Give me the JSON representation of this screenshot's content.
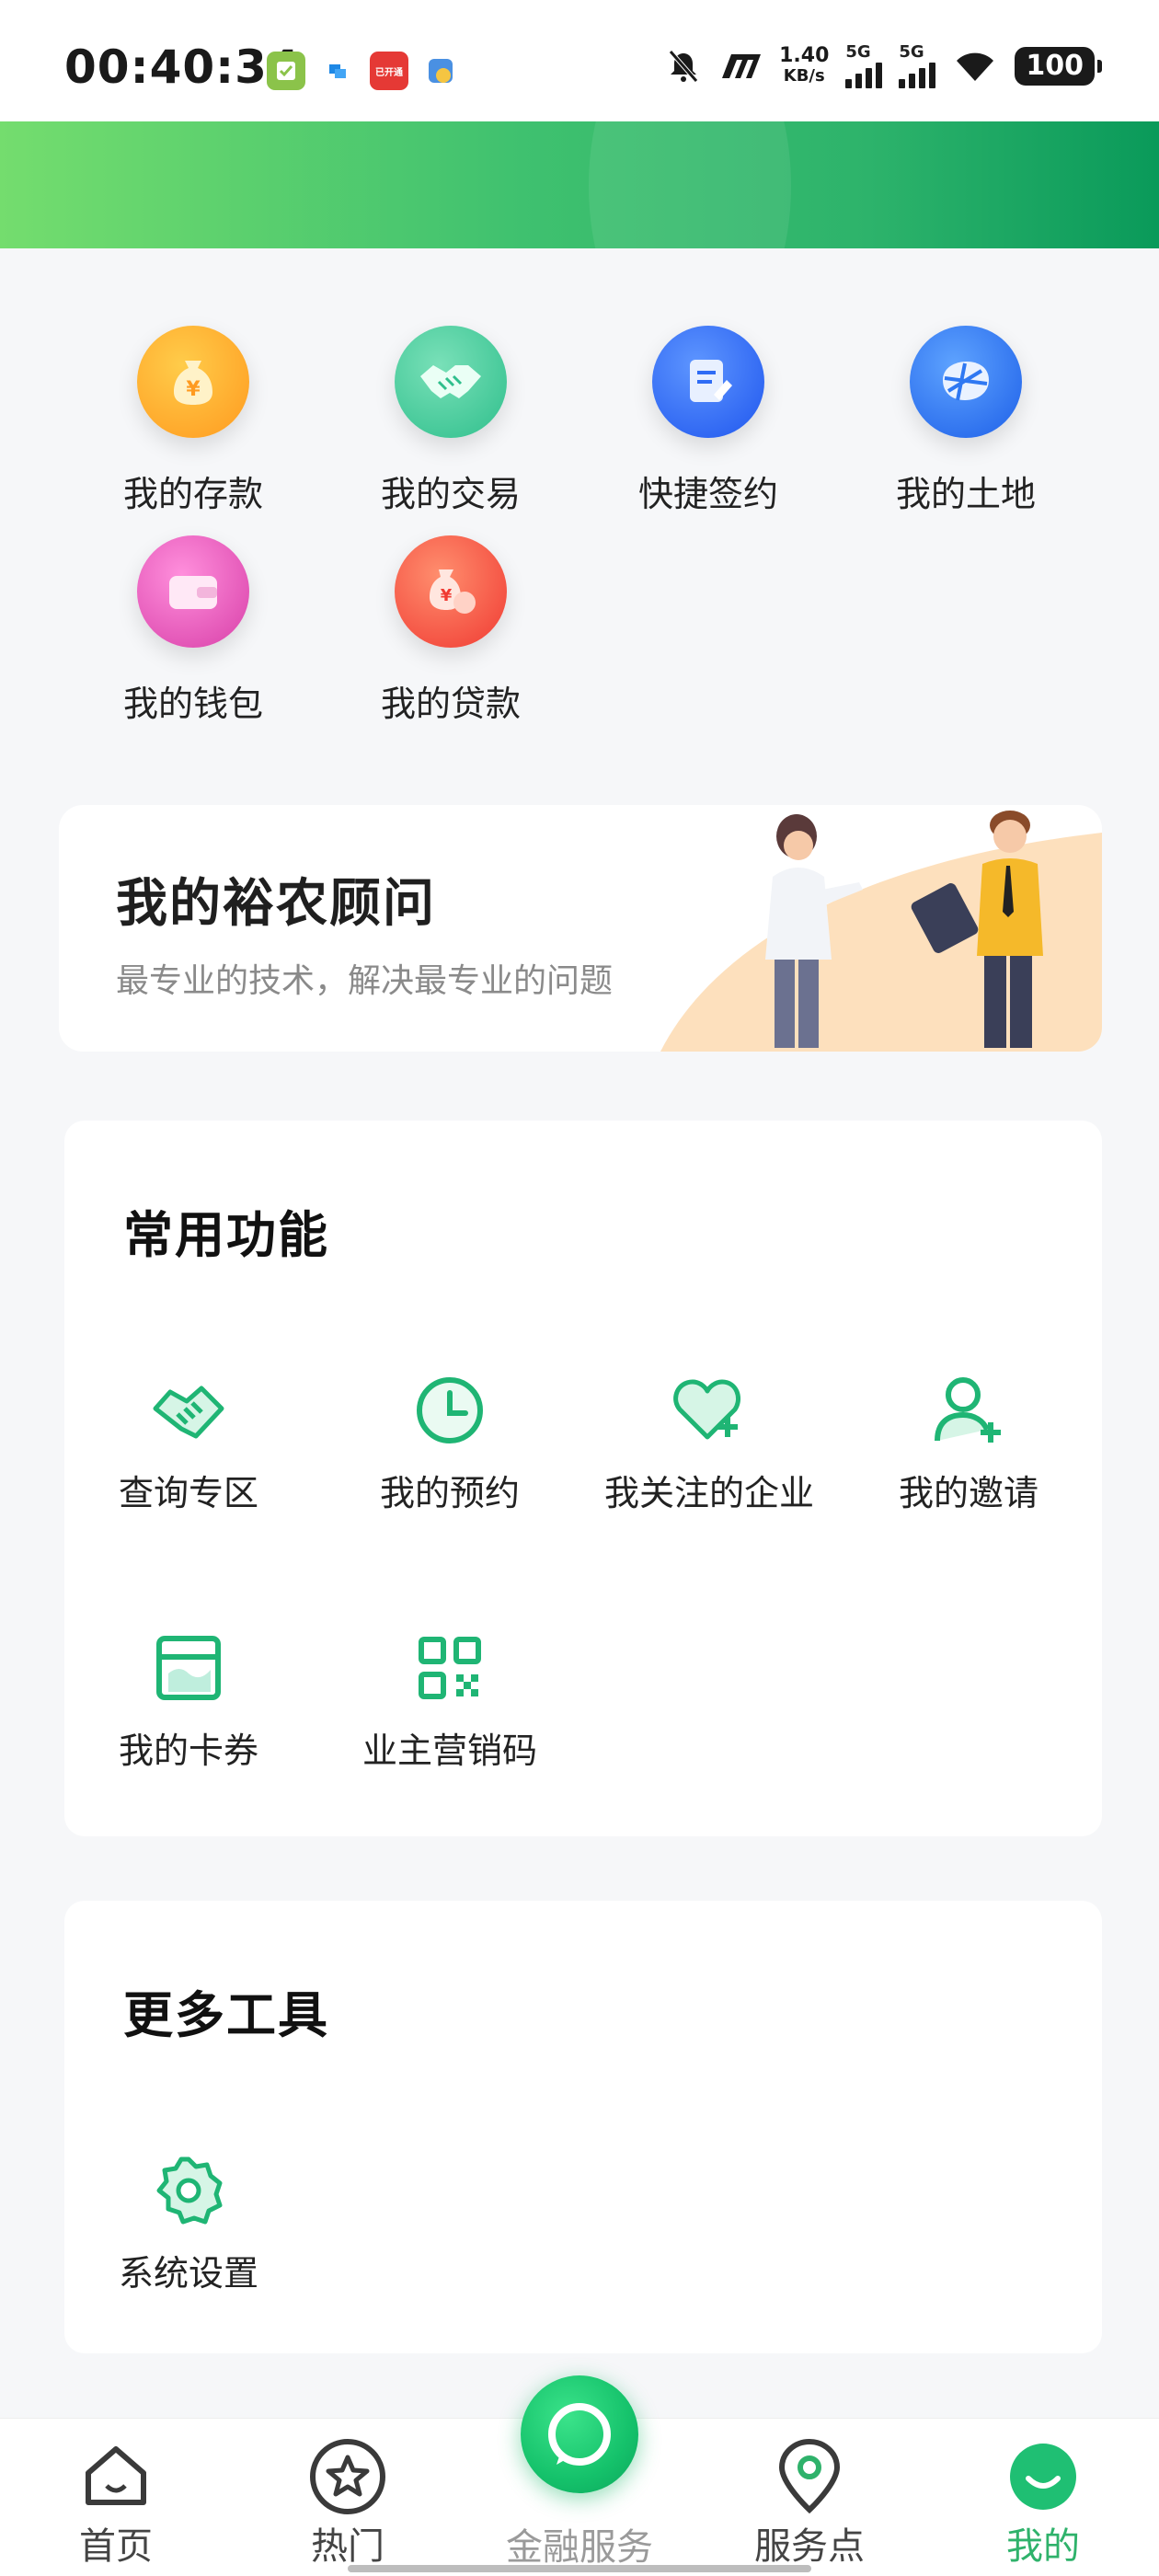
{
  "status_bar": {
    "time": "00:40:34",
    "net_speed_value": "1.40",
    "net_speed_unit": "KB/s",
    "sim1": "5G",
    "sim2": "5G",
    "battery": "100",
    "app_badge": "已开通"
  },
  "assets": [
    {
      "label": "我的存款",
      "icon": "money-bag-icon",
      "color": "#ffa024"
    },
    {
      "label": "我的交易",
      "icon": "handshake-icon",
      "color": "#38c89a"
    },
    {
      "label": "快捷签约",
      "icon": "document-sign-icon",
      "color": "#2f6cf5"
    },
    {
      "label": "我的土地",
      "icon": "land-grid-icon",
      "color": "#2f78f2"
    },
    {
      "label": "我的钱包",
      "icon": "wallet-icon",
      "color": "#e84fb2"
    },
    {
      "label": "我的贷款",
      "icon": "loan-bag-icon",
      "color": "#f44b3e"
    }
  ],
  "advisor": {
    "title": "我的裕农顾问",
    "subtitle": "最专业的技术，解决最专业的问题"
  },
  "common_functions": {
    "title": "常用功能",
    "items": [
      {
        "label": "查询专区",
        "icon": "handshake-outline-icon"
      },
      {
        "label": "我的预约",
        "icon": "clock-icon"
      },
      {
        "label": "我关注的企业",
        "icon": "heart-plus-icon"
      },
      {
        "label": "我的邀请",
        "icon": "user-plus-icon"
      },
      {
        "label": "我的卡券",
        "icon": "coupon-icon"
      },
      {
        "label": "业主营销码",
        "icon": "qr-code-icon"
      }
    ]
  },
  "more_tools": {
    "title": "更多工具",
    "items": [
      {
        "label": "系统设置",
        "icon": "gear-icon"
      }
    ]
  },
  "bottom_nav": {
    "home": "首页",
    "hot": "热门",
    "finance": "金融服务",
    "service_points": "服务点",
    "mine": "我的"
  },
  "colors": {
    "accent": "#2fb26b",
    "icon_green": "#1fb574"
  }
}
